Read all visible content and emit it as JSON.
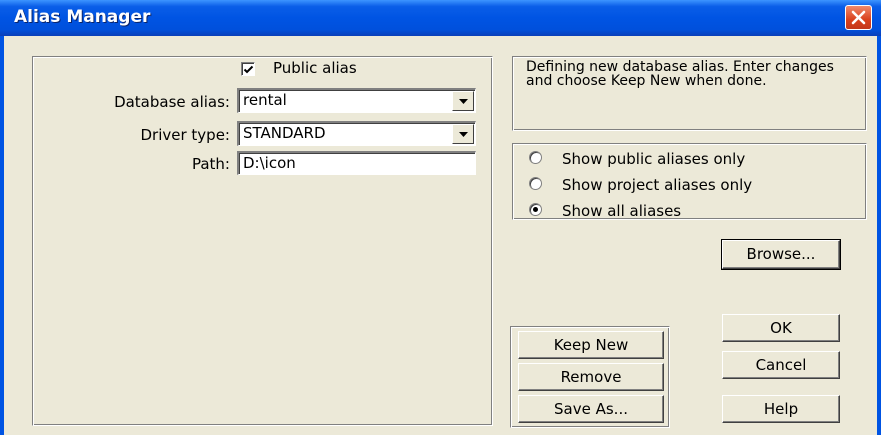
{
  "window": {
    "title": "Alias Manager"
  },
  "public_alias": {
    "label": "Public alias",
    "checked": true
  },
  "database_alias": {
    "label": "Database alias:",
    "value": "rental"
  },
  "driver_type": {
    "label": "Driver type:",
    "value": "STANDARD"
  },
  "path": {
    "label": "Path:",
    "value": "D:\\icon"
  },
  "message": {
    "text": "Defining new database alias. Enter changes and choose Keep New when done."
  },
  "filter": {
    "options": [
      {
        "label": "Show public aliases only",
        "selected": false
      },
      {
        "label": "Show project aliases only",
        "selected": false
      },
      {
        "label": "Show all aliases",
        "selected": true
      }
    ]
  },
  "buttons": {
    "browse": "Browse...",
    "keep_new": "Keep New",
    "remove": "Remove",
    "save_as": "Save As...",
    "ok": "OK",
    "cancel": "Cancel",
    "help": "Help"
  },
  "icons": {
    "close": "close-icon",
    "dropdown": "chevron-down-icon",
    "check": "check-icon"
  },
  "colors": {
    "titlebar": "#0054e3",
    "close_button": "#d9411d",
    "window_bg": "#ece9d8"
  }
}
